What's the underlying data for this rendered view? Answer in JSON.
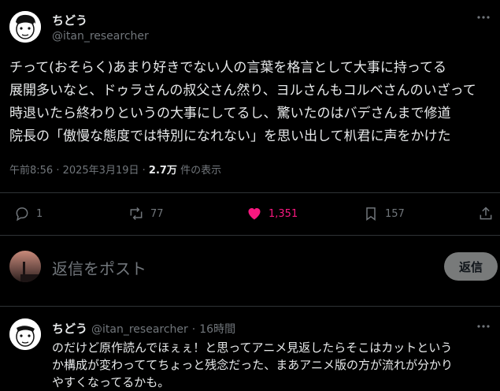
{
  "main_post": {
    "author_name": "ちどう",
    "author_handle": "@itan_researcher",
    "lines": [
      "チって(おそらく)あまり好きでない人の言葉を格言として大事に持ってる",
      "展開多いなと、ドゥラさんの叔父さん然り、ヨルさんもコルベさんのいざって",
      "時退いたら終わりというの大事にしてるし、驚いたのはバデさんまで修道",
      "院長の「傲慢な態度では特別になれない」を思い出して朳君に声をかけた"
    ],
    "timestamp": "午前8:56 · 2025年3月19日 ·",
    "views_count": "2.7万",
    "views_label": "件の表示"
  },
  "actions": {
    "reply_count": "1",
    "repost_count": "77",
    "like_count": "1,351",
    "bookmark_count": "157"
  },
  "compose": {
    "placeholder": "返信をポスト",
    "button_label": "返信"
  },
  "reply_post": {
    "author_name": "ちどう",
    "author_handle": "@itan_researcher",
    "separator": "·",
    "time": "16時間",
    "lines": [
      "のだけど原作読んでほぇぇ！と思ってアニメ見返したらそこはカットという",
      "か構成が変わっててちょっと残念だった、まあアニメ版の方が流れが分かり",
      "やすくなってるかも。"
    ]
  },
  "colors": {
    "background": "#000000",
    "text": "#e7e9ea",
    "muted": "#71767b",
    "like": "#f91880",
    "divider": "#2f3336"
  }
}
